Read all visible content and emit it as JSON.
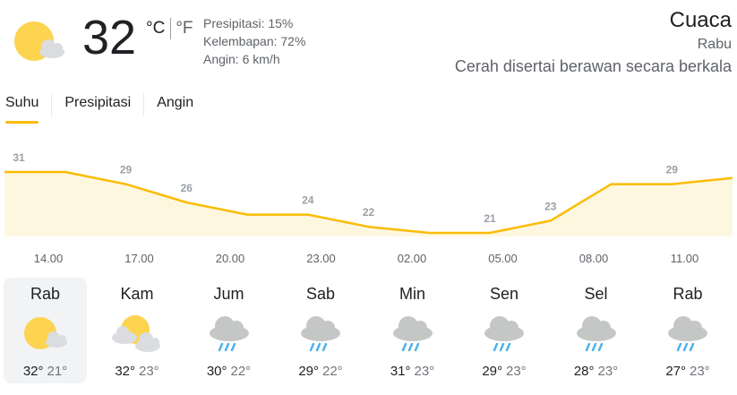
{
  "current": {
    "temperature": "32",
    "unit_c": "°C",
    "unit_f": "°F",
    "icon": "partly-sunny-icon",
    "precipitation": "Presipitasi: 15%",
    "humidity": "Kelembapan: 72%",
    "wind": "Angin: 6 km/h"
  },
  "header": {
    "title": "Cuaca",
    "day": "Rabu",
    "condition": "Cerah disertai berawan secara berkala"
  },
  "tabs": [
    {
      "label": "Suhu",
      "active": true
    },
    {
      "label": "Presipitasi",
      "active": false
    },
    {
      "label": "Angin",
      "active": false
    }
  ],
  "chart_data": {
    "type": "area",
    "values": [
      31,
      31,
      29,
      26,
      24,
      24,
      22,
      21,
      21,
      23,
      29,
      29,
      30
    ],
    "labels": [
      "31",
      "29",
      "26",
      "24",
      "22",
      "21",
      "23",
      "29"
    ],
    "label_positions": [
      0,
      2,
      3,
      5,
      6,
      8,
      9,
      11
    ],
    "x_ticks": [
      "14.00",
      "17.00",
      "20.00",
      "23.00",
      "02.00",
      "05.00",
      "08.00",
      "11.00"
    ],
    "line_color": "#fbbc04",
    "fill_color": "#fef7e0"
  },
  "forecast": [
    {
      "day": "Rab",
      "icon": "sun-cloud-icon",
      "high": "32°",
      "low": "21°",
      "active": true
    },
    {
      "day": "Kam",
      "icon": "sun-clouds-icon",
      "high": "32°",
      "low": "23°",
      "active": false
    },
    {
      "day": "Jum",
      "icon": "rain-icon",
      "high": "30°",
      "low": "22°",
      "active": false
    },
    {
      "day": "Sab",
      "icon": "rain-icon",
      "high": "29°",
      "low": "22°",
      "active": false
    },
    {
      "day": "Min",
      "icon": "rain-icon",
      "high": "31°",
      "low": "23°",
      "active": false
    },
    {
      "day": "Sen",
      "icon": "rain-icon",
      "high": "29°",
      "low": "23°",
      "active": false
    },
    {
      "day": "Sel",
      "icon": "rain-icon",
      "high": "28°",
      "low": "23°",
      "active": false
    },
    {
      "day": "Rab",
      "icon": "rain-icon",
      "high": "27°",
      "low": "23°",
      "active": false
    }
  ]
}
